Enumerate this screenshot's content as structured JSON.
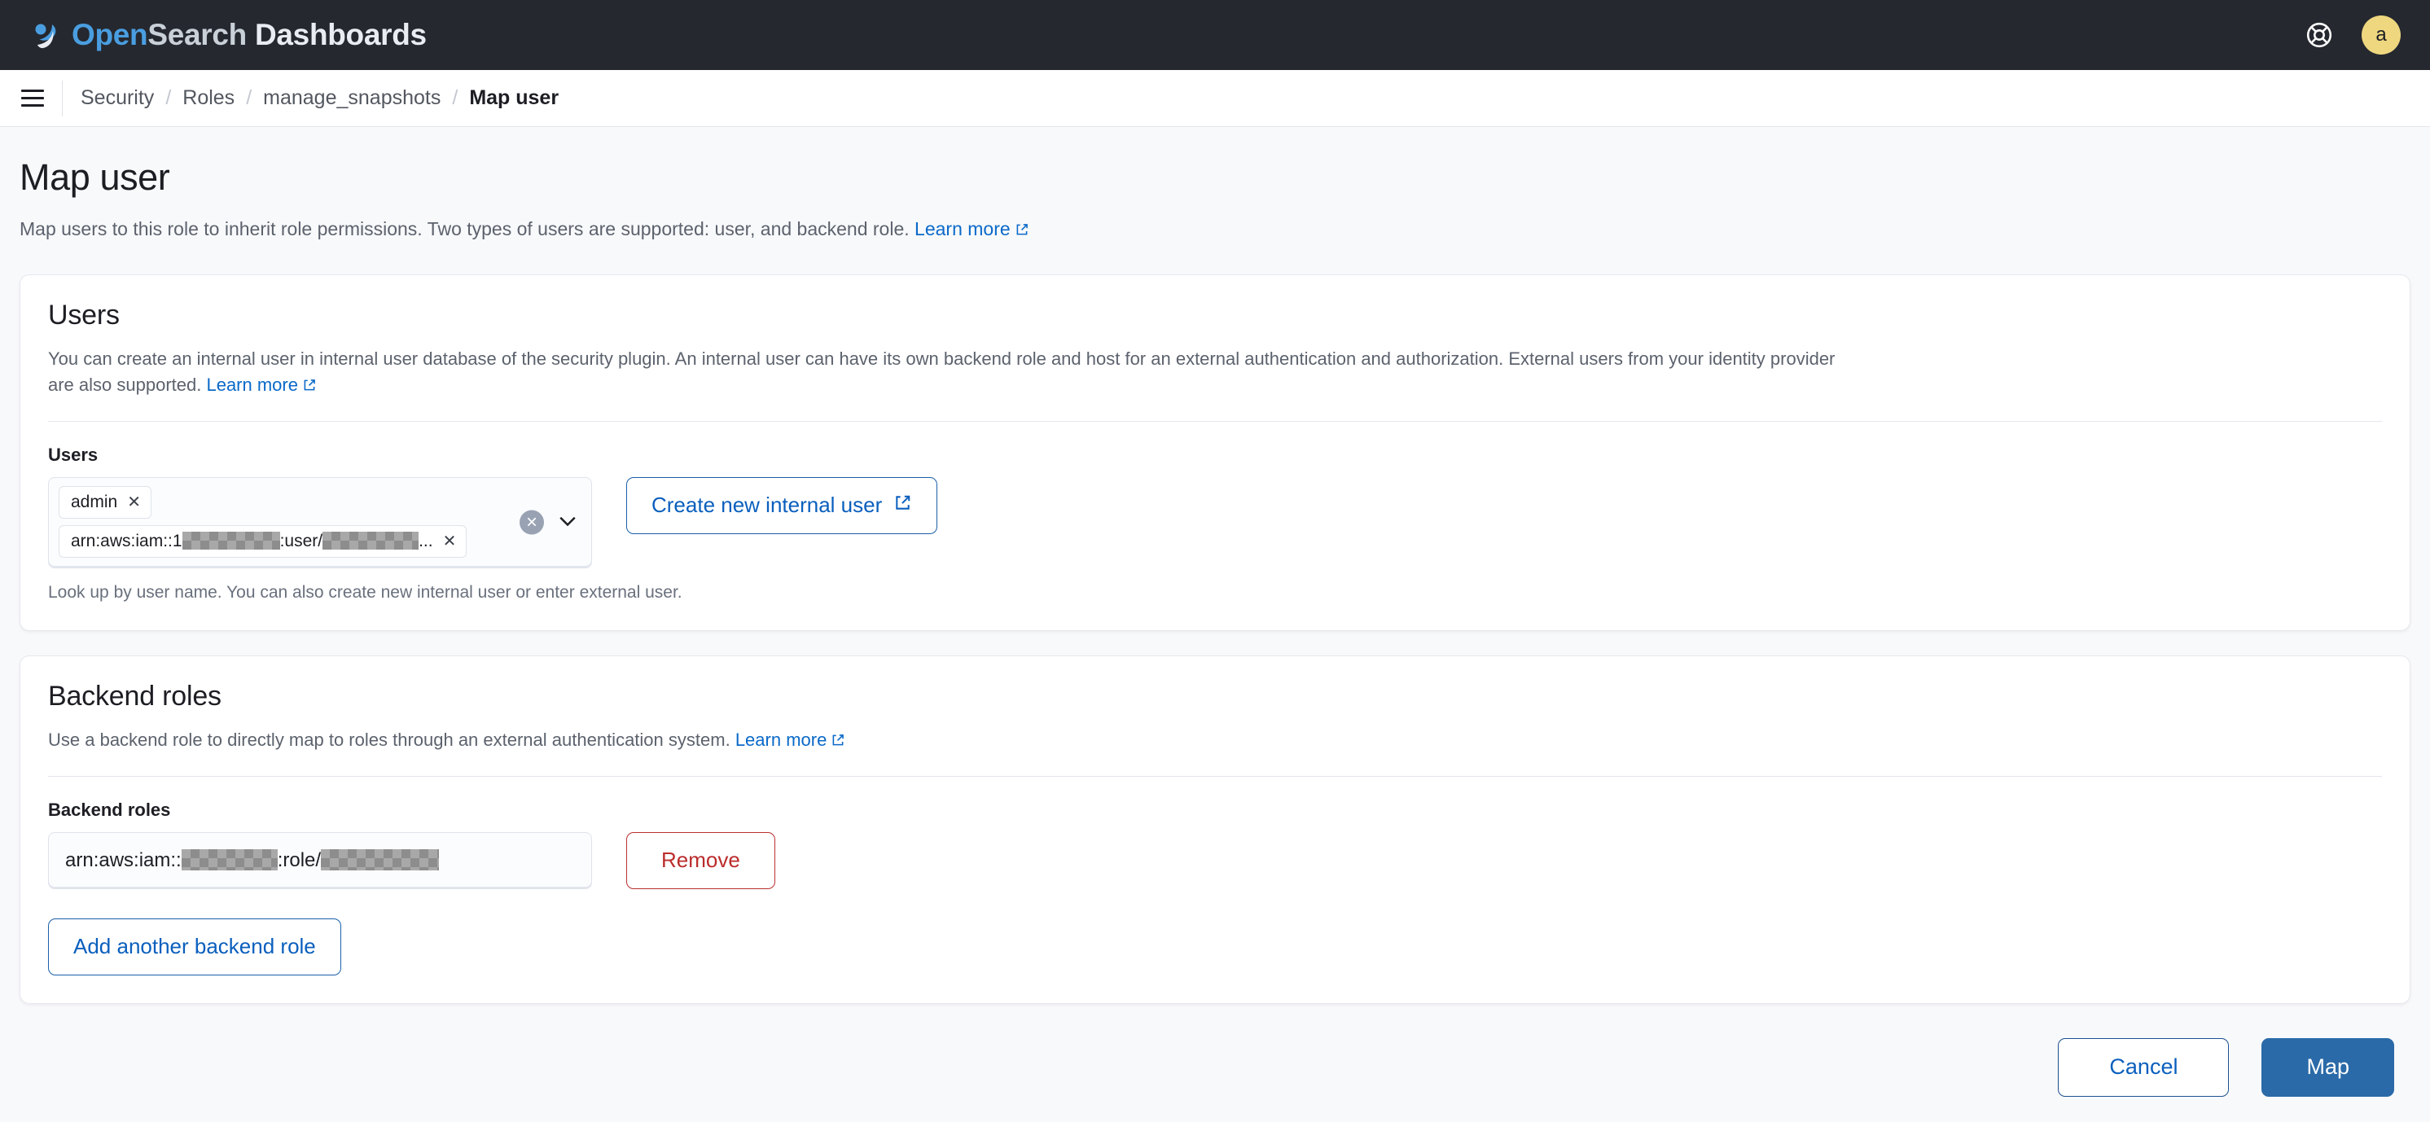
{
  "header": {
    "brand_open": "Open",
    "brand_search": "Search",
    "brand_dashboards": " Dashboards",
    "help_icon": "life-ring-help-icon",
    "avatar_initial": "a"
  },
  "breadcrumb": {
    "menu_icon": "hamburger-menu-icon",
    "items": [
      {
        "label": "Security",
        "current": false
      },
      {
        "label": "Roles",
        "current": false
      },
      {
        "label": "manage_snapshots",
        "current": false
      },
      {
        "label": "Map user",
        "current": true
      }
    ],
    "separator": "/"
  },
  "page": {
    "title": "Map user",
    "description": "Map users to this role to inherit role permissions. Two types of users are supported: user, and backend role.",
    "learn_more": "Learn more"
  },
  "users_panel": {
    "title": "Users",
    "description": "You can create an internal user in internal user database of the security plugin. An internal user can have its own backend role and host for an external authentication and authorization. External users from your identity provider are also supported.",
    "learn_more": "Learn more",
    "field_label": "Users",
    "pills": [
      {
        "text": "admin",
        "redacted": false
      },
      {
        "text_before": "arn:aws:iam::1",
        "text_middle": ":user/",
        "text_after": "...",
        "redacted": true
      }
    ],
    "clear_icon": "clear-selection-icon",
    "dropdown_icon": "chevron-down-icon",
    "helper_text": "Look up by user name. You can also create new internal user or enter external user.",
    "create_user_button": "Create new internal user",
    "external_link_icon": "external-link-icon"
  },
  "backend_panel": {
    "title": "Backend roles",
    "description": "Use a backend role to directly map to roles through an external authentication system.",
    "learn_more": "Learn more",
    "field_label": "Backend roles",
    "role_value_before": "arn:aws:iam::",
    "role_value_middle": ":role/",
    "remove_button": "Remove",
    "add_button": "Add another backend role"
  },
  "footer": {
    "cancel_button": "Cancel",
    "map_button": "Map"
  },
  "colors": {
    "topbar_bg": "#25282f",
    "page_bg": "#f8f9fb",
    "panel_bg": "#ffffff",
    "link_blue": "#0a69c9",
    "primary_blue": "#2a6aa8",
    "danger_red": "#bb2c2c",
    "avatar_yellow": "#eed77f"
  }
}
